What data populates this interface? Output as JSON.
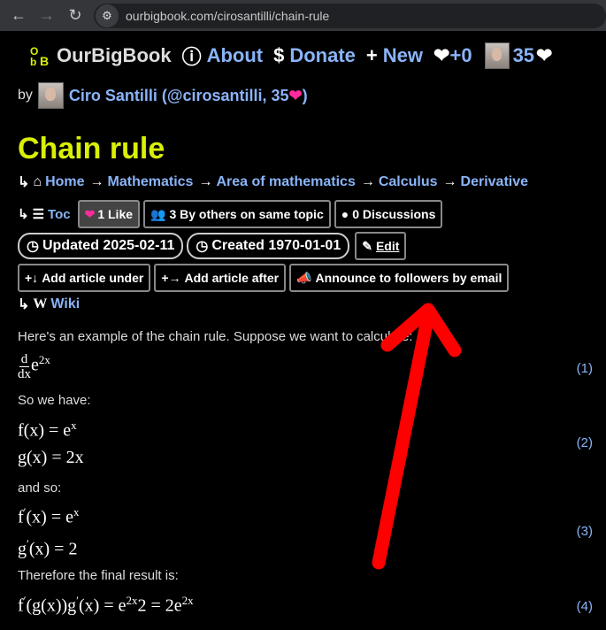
{
  "browser": {
    "url": "ourbigbook.com/cirosantilli/chain-rule"
  },
  "site": {
    "brand": "OurBigBook",
    "about": "About",
    "donate": "Donate",
    "new": "New",
    "likes_count": "+0",
    "user_score": "35"
  },
  "byline": {
    "by": "by",
    "author": "Ciro Santilli (@cirosantilli, 35",
    "author_close": ")"
  },
  "article": {
    "title": "Chain rule",
    "breadcrumbs": [
      "Home",
      "Mathematics",
      "Area of mathematics",
      "Calculus",
      "Derivative"
    ],
    "toc": "Toc",
    "like": "1 Like",
    "by_others": "3 By others on same topic",
    "discussions": "0 Discussions",
    "updated": "Updated 2025-02-11",
    "created": "Created 1970-01-01",
    "edit": "Edit",
    "add_under": "Add article under",
    "add_after": "Add article after",
    "announce": "Announce to followers by email",
    "wiki": "Wiki"
  },
  "content": {
    "p1": "Here's an example of the chain rule. Suppose we want to calculate:",
    "p2": "So we have:",
    "p3": "and so:",
    "p4": "Therefore the final result is:",
    "eq1": "(1)",
    "eq2": "(2)",
    "eq3": "(3)",
    "eq4": "(4)"
  },
  "colors": {
    "title": "#d9f005",
    "link": "#8ab4f8",
    "annotation_arrow": "#ff0000",
    "heart": "#ff2a9d"
  }
}
